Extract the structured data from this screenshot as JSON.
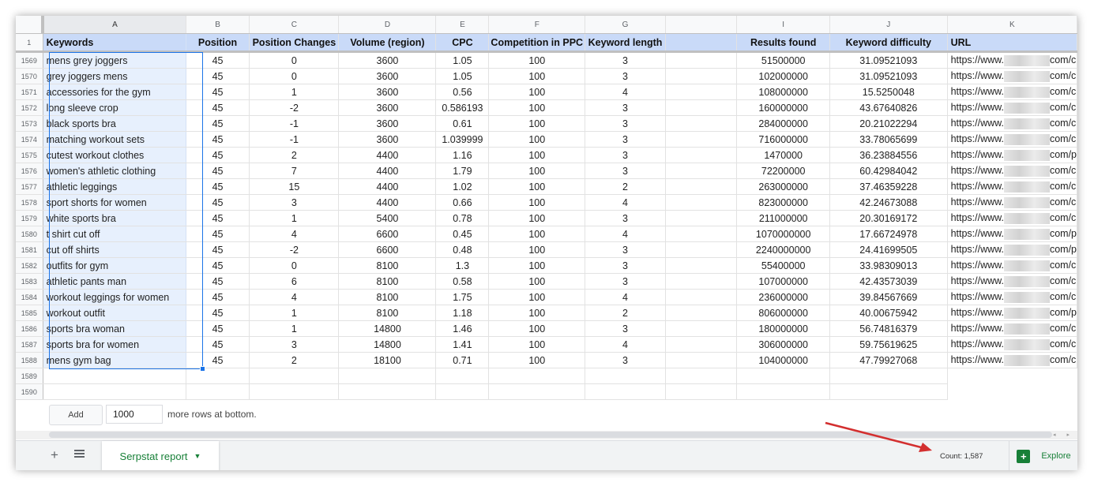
{
  "columns": [
    "A",
    "B",
    "C",
    "D",
    "E",
    "F",
    "G",
    "",
    "I",
    "J",
    "K"
  ],
  "header": {
    "row_num": "1",
    "cells": [
      "Keywords",
      "Position",
      "Position Changes",
      "Volume (region)",
      "CPC",
      "Competition in PPC",
      "Keyword length",
      "Results found",
      "Keyword difficulty",
      "URL"
    ]
  },
  "rows": [
    {
      "n": "1569",
      "kw": "mens grey joggers",
      "pos": "45",
      "chg": "0",
      "vol": "3600",
      "cpc": "1.05",
      "comp": "100",
      "len": "3",
      "res": "51500000",
      "diff": "31.09521093",
      "url_a": "https://www.",
      "url_b": "com/c"
    },
    {
      "n": "1570",
      "kw": "grey joggers mens",
      "pos": "45",
      "chg": "0",
      "vol": "3600",
      "cpc": "1.05",
      "comp": "100",
      "len": "3",
      "res": "102000000",
      "diff": "31.09521093",
      "url_a": "https://www.",
      "url_b": "com/c"
    },
    {
      "n": "1571",
      "kw": "accessories for the gym",
      "pos": "45",
      "chg": "1",
      "vol": "3600",
      "cpc": "0.56",
      "comp": "100",
      "len": "4",
      "res": "108000000",
      "diff": "15.5250048",
      "url_a": "https://www.",
      "url_b": "com/c"
    },
    {
      "n": "1572",
      "kw": "long sleeve crop",
      "pos": "45",
      "chg": "-2",
      "vol": "3600",
      "cpc": "0.586193",
      "comp": "100",
      "len": "3",
      "res": "160000000",
      "diff": "43.67640826",
      "url_a": "https://www.",
      "url_b": "com/c"
    },
    {
      "n": "1573",
      "kw": "black sports bra",
      "pos": "45",
      "chg": "-1",
      "vol": "3600",
      "cpc": "0.61",
      "comp": "100",
      "len": "3",
      "res": "284000000",
      "diff": "20.21022294",
      "url_a": "https://www.",
      "url_b": "com/c"
    },
    {
      "n": "1574",
      "kw": "matching workout sets",
      "pos": "45",
      "chg": "-1",
      "vol": "3600",
      "cpc": "1.039999",
      "comp": "100",
      "len": "3",
      "res": "716000000",
      "diff": "33.78065699",
      "url_a": "https://www.",
      "url_b": "com/c"
    },
    {
      "n": "1575",
      "kw": "cutest workout clothes",
      "pos": "45",
      "chg": "2",
      "vol": "4400",
      "cpc": "1.16",
      "comp": "100",
      "len": "3",
      "res": "1470000",
      "diff": "36.23884556",
      "url_a": "https://www.",
      "url_b": "com/p"
    },
    {
      "n": "1576",
      "kw": "women's athletic clothing",
      "pos": "45",
      "chg": "7",
      "vol": "4400",
      "cpc": "1.79",
      "comp": "100",
      "len": "3",
      "res": "72200000",
      "diff": "60.42984042",
      "url_a": "https://www.",
      "url_b": "com/c"
    },
    {
      "n": "1577",
      "kw": "athletic leggings",
      "pos": "45",
      "chg": "15",
      "vol": "4400",
      "cpc": "1.02",
      "comp": "100",
      "len": "2",
      "res": "263000000",
      "diff": "37.46359228",
      "url_a": "https://www.",
      "url_b": "com/c"
    },
    {
      "n": "1578",
      "kw": "sport shorts for women",
      "pos": "45",
      "chg": "3",
      "vol": "4400",
      "cpc": "0.66",
      "comp": "100",
      "len": "4",
      "res": "823000000",
      "diff": "42.24673088",
      "url_a": "https://www.",
      "url_b": "com/c"
    },
    {
      "n": "1579",
      "kw": "white sports bra",
      "pos": "45",
      "chg": "1",
      "vol": "5400",
      "cpc": "0.78",
      "comp": "100",
      "len": "3",
      "res": "211000000",
      "diff": "20.30169172",
      "url_a": "https://www.",
      "url_b": "com/c"
    },
    {
      "n": "1580",
      "kw": "t shirt cut off",
      "pos": "45",
      "chg": "4",
      "vol": "6600",
      "cpc": "0.45",
      "comp": "100",
      "len": "4",
      "res": "1070000000",
      "diff": "17.66724978",
      "url_a": "https://www.",
      "url_b": "com/p"
    },
    {
      "n": "1581",
      "kw": "cut off shirts",
      "pos": "45",
      "chg": "-2",
      "vol": "6600",
      "cpc": "0.48",
      "comp": "100",
      "len": "3",
      "res": "2240000000",
      "diff": "24.41699505",
      "url_a": "https://www.",
      "url_b": "com/p"
    },
    {
      "n": "1582",
      "kw": "outfits for gym",
      "pos": "45",
      "chg": "0",
      "vol": "8100",
      "cpc": "1.3",
      "comp": "100",
      "len": "3",
      "res": "55400000",
      "diff": "33.98309013",
      "url_a": "https://www.",
      "url_b": "com/c"
    },
    {
      "n": "1583",
      "kw": "athletic pants man",
      "pos": "45",
      "chg": "6",
      "vol": "8100",
      "cpc": "0.58",
      "comp": "100",
      "len": "3",
      "res": "107000000",
      "diff": "42.43573039",
      "url_a": "https://www.",
      "url_b": "com/c"
    },
    {
      "n": "1584",
      "kw": "workout leggings for women",
      "pos": "45",
      "chg": "4",
      "vol": "8100",
      "cpc": "1.75",
      "comp": "100",
      "len": "4",
      "res": "236000000",
      "diff": "39.84567669",
      "url_a": "https://www.",
      "url_b": "com/c"
    },
    {
      "n": "1585",
      "kw": "workout outfit",
      "pos": "45",
      "chg": "1",
      "vol": "8100",
      "cpc": "1.18",
      "comp": "100",
      "len": "2",
      "res": "806000000",
      "diff": "40.00675942",
      "url_a": "https://www.",
      "url_b": "com/p"
    },
    {
      "n": "1586",
      "kw": "sports bra woman",
      "pos": "45",
      "chg": "1",
      "vol": "14800",
      "cpc": "1.46",
      "comp": "100",
      "len": "3",
      "res": "180000000",
      "diff": "56.74816379",
      "url_a": "https://www.",
      "url_b": "com/c"
    },
    {
      "n": "1587",
      "kw": "sports bra for women",
      "pos": "45",
      "chg": "3",
      "vol": "14800",
      "cpc": "1.41",
      "comp": "100",
      "len": "4",
      "res": "306000000",
      "diff": "59.75619625",
      "url_a": "https://www.",
      "url_b": "com/c"
    },
    {
      "n": "1588",
      "kw": "mens gym bag",
      "pos": "45",
      "chg": "2",
      "vol": "18100",
      "cpc": "0.71",
      "comp": "100",
      "len": "3",
      "res": "104000000",
      "diff": "47.79927068",
      "url_a": "https://www.",
      "url_b": "com/c"
    }
  ],
  "empty_rows": [
    "1589",
    "1590"
  ],
  "add_rows": {
    "button": "Add",
    "value": "1000",
    "text": "more rows at bottom."
  },
  "sheet_tab": "Serpstat report",
  "status_count": "Count: 1,587",
  "explore": "Explore",
  "colors": {
    "header_fill": "#c9daf8",
    "selection": "#1a73e8",
    "tab_text": "#188038",
    "annotation_arrow": "#d32f2f"
  }
}
